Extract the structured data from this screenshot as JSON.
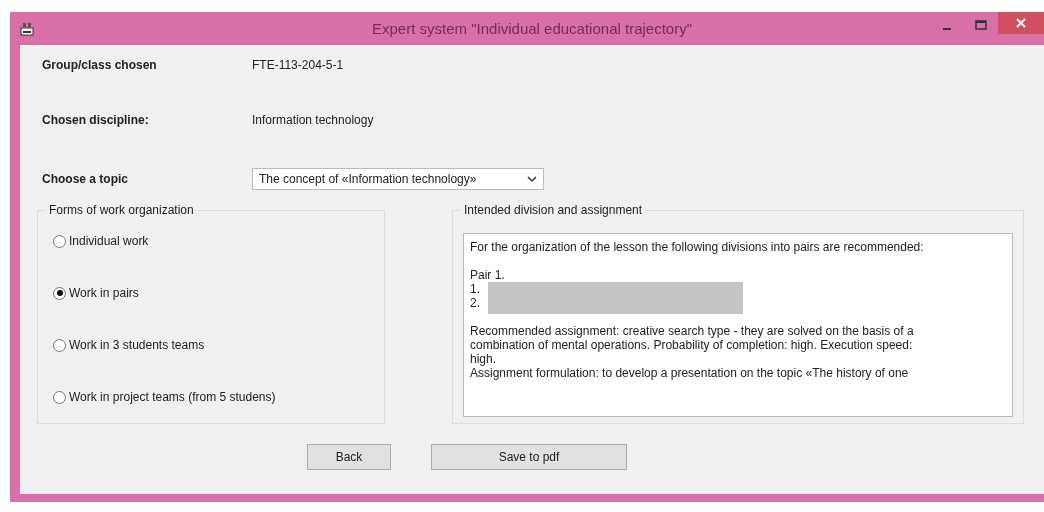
{
  "window": {
    "title": "Expert system \"Individual educational trajectory\""
  },
  "fields": [
    {
      "label": "Group/class chosen",
      "value": "FTE-113-204-5-1"
    },
    {
      "label": "Chosen discipline:",
      "value": "Information technology"
    }
  ],
  "topic": {
    "label": "Choose a topic",
    "value": "The concept of «Information technology»"
  },
  "forms": {
    "title": "Forms of work organization",
    "options": [
      {
        "label": "Individual work",
        "selected": false
      },
      {
        "label": "Work in pairs",
        "selected": true
      },
      {
        "label": "Work in 3 students teams",
        "selected": false
      },
      {
        "label": "Work in project teams (from 5 studens)",
        "selected": false
      }
    ]
  },
  "assignment": {
    "title": "Intended division and assignment",
    "lines": [
      {
        "kind": "text",
        "text": "For the organization of the lesson the following divisions into pairs are recommended:"
      },
      {
        "kind": "blank"
      },
      {
        "kind": "text",
        "text": "Pair 1."
      },
      {
        "kind": "redacted",
        "text": "1."
      },
      {
        "kind": "redacted",
        "text": "2."
      },
      {
        "kind": "blank"
      },
      {
        "kind": "text",
        "text": "Recommended assignment: creative search type  - they are solved on the basis of a"
      },
      {
        "kind": "text",
        "text": "combination of mental operations. Probability of completion: high. Execution speed:"
      },
      {
        "kind": "text",
        "text": "high."
      },
      {
        "kind": "text",
        "text": "Assignment formulation: to develop a presentation on the topic «The history of one"
      }
    ]
  },
  "buttons": [
    "Back",
    "Save to pdf"
  ]
}
